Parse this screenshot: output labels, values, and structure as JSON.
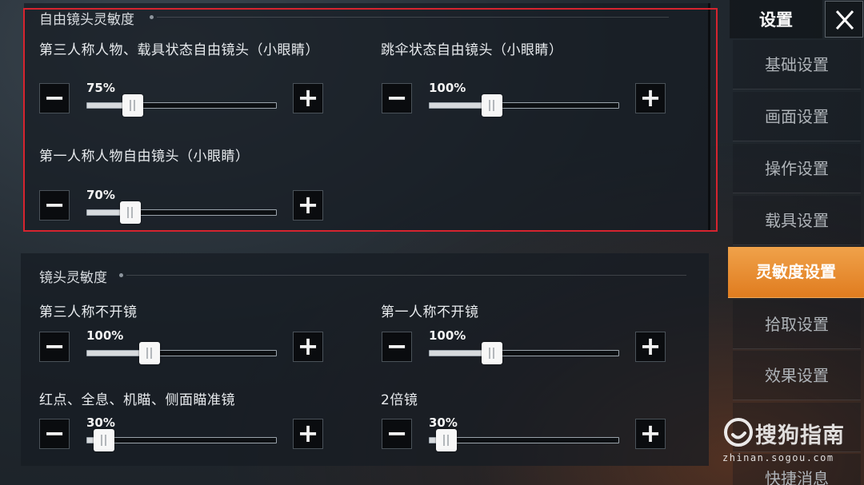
{
  "free_camera": {
    "title": "自由镜头灵敏度",
    "sliders": [
      {
        "label": "第三人称人物、载具状态自由镜头（小眼睛）",
        "value_text": "75%",
        "fraction": 0.24
      },
      {
        "label": "跳伞状态自由镜头（小眼睛）",
        "value_text": "100%",
        "fraction": 0.33
      },
      {
        "label": "第一人称人物自由镜头（小眼睛）",
        "value_text": "70%",
        "fraction": 0.23
      }
    ]
  },
  "lens": {
    "title": "镜头灵敏度",
    "sliders": [
      {
        "label": "第三人称不开镜",
        "value_text": "100%",
        "fraction": 0.33
      },
      {
        "label": "第一人称不开镜",
        "value_text": "100%",
        "fraction": 0.33
      },
      {
        "label": "红点、全息、机瞄、侧面瞄准镜",
        "value_text": "30%",
        "fraction": 0.09
      },
      {
        "label": "2倍镜",
        "value_text": "30%",
        "fraction": 0.09
      }
    ]
  },
  "buttons": {
    "minus": "−",
    "plus": "+"
  },
  "sidebar": {
    "title": "设置",
    "close_icon": "close-icon",
    "items": [
      {
        "label": "基础设置",
        "active": false
      },
      {
        "label": "画面设置",
        "active": false
      },
      {
        "label": "操作设置",
        "active": false
      },
      {
        "label": "载具设置",
        "active": false
      },
      {
        "label": "灵敏度设置",
        "active": true
      },
      {
        "label": "拾取设置",
        "active": false
      },
      {
        "label": "效果设置",
        "active": false
      },
      {
        "label": "",
        "active": false
      },
      {
        "label": "快捷消息",
        "active": false
      }
    ]
  },
  "watermark": {
    "text": "搜狗指南",
    "url": "zhinan.sogou.com"
  },
  "colors": {
    "accent": "#e8892c",
    "highlight_border": "#d6242f",
    "panel": "#161c22"
  }
}
